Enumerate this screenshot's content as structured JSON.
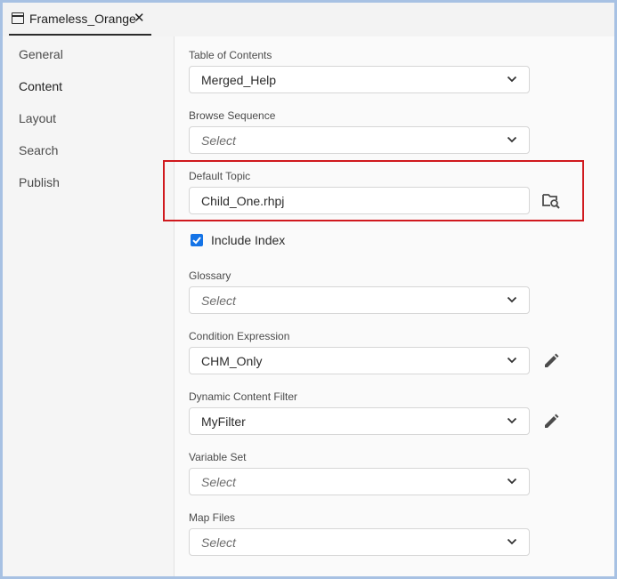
{
  "tab": {
    "title": "Frameless_Orange",
    "close_label": "✕"
  },
  "sidebar": {
    "items": [
      {
        "label": "General"
      },
      {
        "label": "Content"
      },
      {
        "label": "Layout"
      },
      {
        "label": "Search"
      },
      {
        "label": "Publish"
      }
    ],
    "active": "Content"
  },
  "form": {
    "toc": {
      "label": "Table of Contents",
      "value": "Merged_Help"
    },
    "browse_sequence": {
      "label": "Browse Sequence",
      "placeholder": "Select"
    },
    "default_topic": {
      "label": "Default Topic",
      "value": "Child_One.rhpj"
    },
    "include_index": {
      "label": "Include Index",
      "checked": true
    },
    "glossary": {
      "label": "Glossary",
      "placeholder": "Select"
    },
    "condition_expression": {
      "label": "Condition Expression",
      "value": "CHM_Only"
    },
    "dynamic_content_filter": {
      "label": "Dynamic Content Filter",
      "value": "MyFilter"
    },
    "variable_set": {
      "label": "Variable Set",
      "placeholder": "Select"
    },
    "map_files": {
      "label": "Map Files",
      "placeholder": "Select"
    }
  },
  "colors": {
    "accent": "#1473e6",
    "highlight": "#d0191e",
    "frame": "#a7c1e3"
  },
  "icons": [
    "window-icon",
    "close-icon",
    "chevron-down-icon",
    "browse-topic-icon",
    "edit-pencil-icon",
    "checkmark-icon"
  ]
}
